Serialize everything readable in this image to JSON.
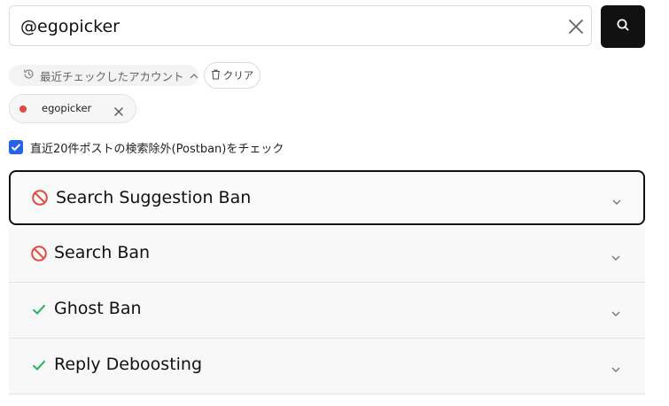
{
  "search": {
    "value": "@egopicker",
    "placeholder": ""
  },
  "recent": {
    "toggle_label": "最近チェックしたアカウント",
    "clear_label": "クリア",
    "accounts": [
      {
        "handle": "egopicker",
        "status_color": "#e5483e"
      }
    ]
  },
  "options": {
    "postban_check_label": "直近20件ポストの検索除外(Postban)をチェック",
    "postban_checked": true
  },
  "results": [
    {
      "title": "Search Suggestion Ban",
      "status": "banned",
      "icon": "prohibited-icon",
      "color": "#e5483e",
      "expanded_focus": true
    },
    {
      "title": "Search Ban",
      "status": "banned",
      "icon": "prohibited-icon",
      "color": "#e5483e"
    },
    {
      "title": "Ghost Ban",
      "status": "ok",
      "icon": "checkmark-icon",
      "color": "#22b35a"
    },
    {
      "title": "Reply Deboosting",
      "status": "ok",
      "icon": "checkmark-icon",
      "color": "#22b35a"
    }
  ],
  "colors": {
    "accent_dark": "#111111",
    "checkbox": "#2563eb",
    "danger": "#e5483e",
    "success": "#22b35a"
  }
}
